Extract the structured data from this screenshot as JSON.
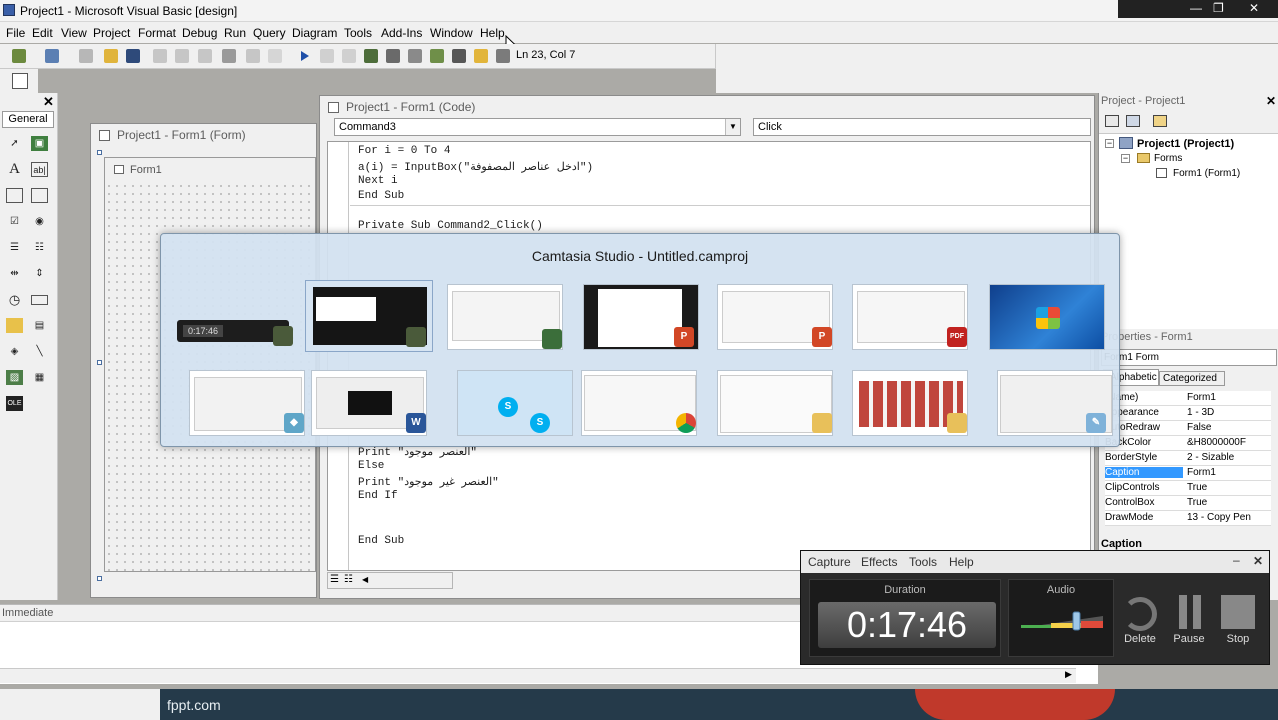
{
  "window": {
    "title": "Project1 - Microsoft Visual Basic [design]",
    "controls": [
      "—",
      "❐",
      "✕"
    ]
  },
  "menu": [
    "File",
    "Edit",
    "View",
    "Project",
    "Format",
    "Debug",
    "Run",
    "Query",
    "Diagram",
    "Tools",
    "Add-Ins",
    "Window",
    "Help"
  ],
  "toolbar": {
    "position": "Ln 23, Col 7"
  },
  "toolbox": {
    "tab": "General",
    "items": [
      "pointer",
      "picturebox",
      "A",
      "ab|",
      "frame",
      "button",
      "checkbox",
      "option",
      "combo",
      "list",
      "hscroll",
      "vscroll",
      "timer",
      "drive",
      "dir",
      "file",
      "shape",
      "line",
      "image",
      "data",
      "ole"
    ]
  },
  "form_window": {
    "title": "Project1 - Form1 (Form)",
    "form_caption": "Form1"
  },
  "code_window": {
    "title": "Project1 - Form1 (Code)",
    "object": "Command3",
    "procedure": "Click",
    "lines_top": [
      "For i = 0 To 4",
      "a(i) = InputBox(\"ادخل عناصر المصفوفة\")",
      "Next i",
      "End Sub"
    ],
    "line_proc": "Private Sub Command2_Click()",
    "lines_bottom": [
      "Print \"العنصر موجود\"",
      "Else",
      "Print \"العنصر غير موجود\"",
      "End If",
      "",
      "End Sub"
    ]
  },
  "project_pane": {
    "title": "Project - Project1",
    "root": "Project1 (Project1)",
    "folder": "Forms",
    "item": "Form1 (Form1)"
  },
  "properties_pane": {
    "title": "Properties - Form1",
    "object": "Form1 Form",
    "tabs": [
      "Alphabetic",
      "Categorized"
    ],
    "rows": [
      {
        "name": "(Name)",
        "value": "Form1"
      },
      {
        "name": "Appearance",
        "value": "1 - 3D"
      },
      {
        "name": "AutoRedraw",
        "value": "False"
      },
      {
        "name": "BackColor",
        "value": "&H8000000F"
      },
      {
        "name": "BorderStyle",
        "value": "2 - Sizable"
      },
      {
        "name": "Caption",
        "value": "Form1"
      },
      {
        "name": "ClipControls",
        "value": "True"
      },
      {
        "name": "ControlBox",
        "value": "True"
      },
      {
        "name": "DrawMode",
        "value": "13 - Copy Pen"
      }
    ],
    "description": "Caption"
  },
  "immediate": {
    "title": "Immediate"
  },
  "bottom": {
    "brand": "fppt.com"
  },
  "switcher": {
    "title": "Camtasia Studio - Untitled.camproj",
    "thumbs_row1": [
      "camtasia-recorder",
      "camtasia-studio",
      "visual-basic",
      "powerpoint-slides",
      "powerpoint-doc",
      "pdf-doc",
      "windows7-desktop"
    ],
    "thumbs_row2": [
      "explorer-window",
      "word-doc",
      "skype",
      "chrome",
      "folder-list",
      "folder-grid",
      "paint"
    ],
    "recorder_time": "0:17:46"
  },
  "recorder": {
    "menu": [
      "Capture",
      "Effects",
      "Tools",
      "Help"
    ],
    "duration_label": "Duration",
    "duration": "0:17:46",
    "audio_label": "Audio",
    "buttons": [
      "Delete",
      "Pause",
      "Stop"
    ]
  }
}
